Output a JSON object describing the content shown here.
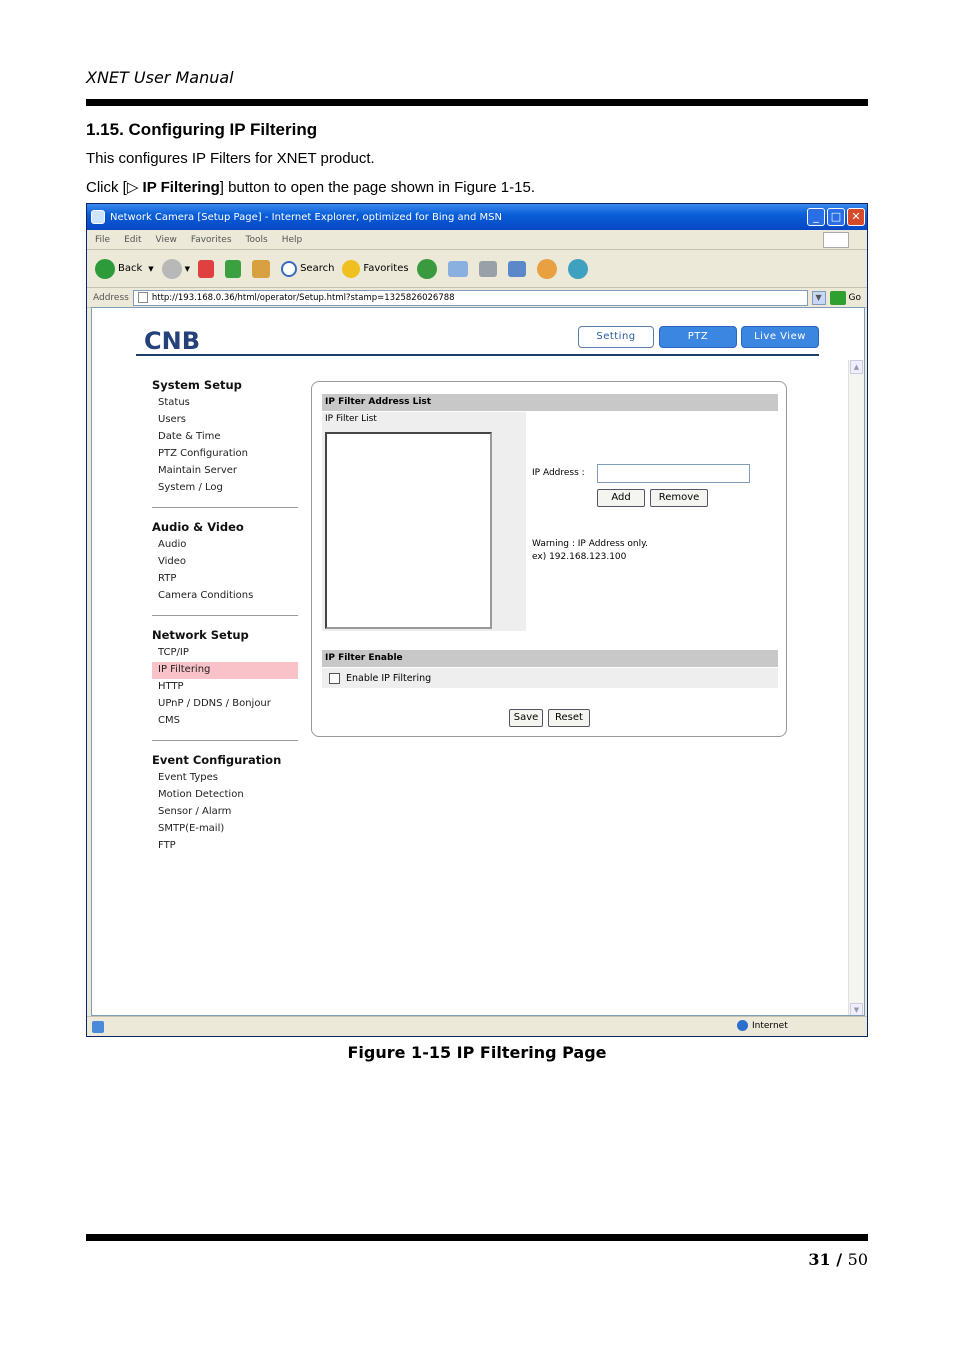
{
  "doc": {
    "header": "XNET User Manual",
    "section_title": "1.15. Configuring IP Filtering",
    "intro": "This configures IP Filters for XNET product.",
    "instruction_pre": "Click [▷ ",
    "instruction_bold": "IP Filtering",
    "instruction_post": "] button to open the page shown in Figure 1-15.",
    "caption": "Figure 1-15 IP Filtering Page",
    "page_current": "31",
    "page_sep": " / ",
    "page_total": "50"
  },
  "browser": {
    "title": "Network Camera [Setup Page] - Internet Explorer, optimized for Bing and MSN",
    "menu": [
      "File",
      "Edit",
      "View",
      "Favorites",
      "Tools",
      "Help"
    ],
    "back_label": "Back",
    "search_label": "Search",
    "favorites_label": "Favorites",
    "address_label": "Address",
    "url": "http://193.168.0.36/html/operator/Setup.html?stamp=1325826026788",
    "go_label": "Go",
    "status_zone": "Internet"
  },
  "camera_page": {
    "logo": "CNB",
    "nav": {
      "setting": "Setting",
      "ptz": "PTZ",
      "live_view": "Live View"
    },
    "sidebar": [
      {
        "head": "System Setup",
        "items": [
          "Status",
          "Users",
          "Date & Time",
          "PTZ Configuration",
          "Maintain Server",
          "System / Log"
        ]
      },
      {
        "head": "Audio & Video",
        "items": [
          "Audio",
          "Video",
          "RTP",
          "Camera Conditions"
        ]
      },
      {
        "head": "Network Setup",
        "items": [
          "TCP/IP",
          "IP Filtering",
          "HTTP",
          "UPnP / DDNS / Bonjour",
          "CMS"
        ]
      },
      {
        "head": "Event Configuration",
        "items": [
          "Event Types",
          "Motion Detection",
          "Sensor / Alarm",
          "SMTP(E-mail)",
          "FTP"
        ]
      }
    ],
    "active_item": "IP Filtering",
    "panel": {
      "list_header": "IP Filter Address List",
      "list_label": "IP Filter List",
      "ip_label": "IP Address :",
      "ip_value": "",
      "add_label": "Add",
      "remove_label": "Remove",
      "warning_line1": "Warning : IP Address only.",
      "warning_line2": "ex) 192.168.123.100",
      "enable_header": "IP Filter Enable",
      "enable_label": "Enable IP Filtering",
      "enable_checked": false,
      "save_label": "Save",
      "reset_label": "Reset"
    }
  },
  "colors": {
    "nav_active": "#3a86e0",
    "sidebar_active": "#f9c1c8",
    "rule": "#1f3d6b"
  }
}
